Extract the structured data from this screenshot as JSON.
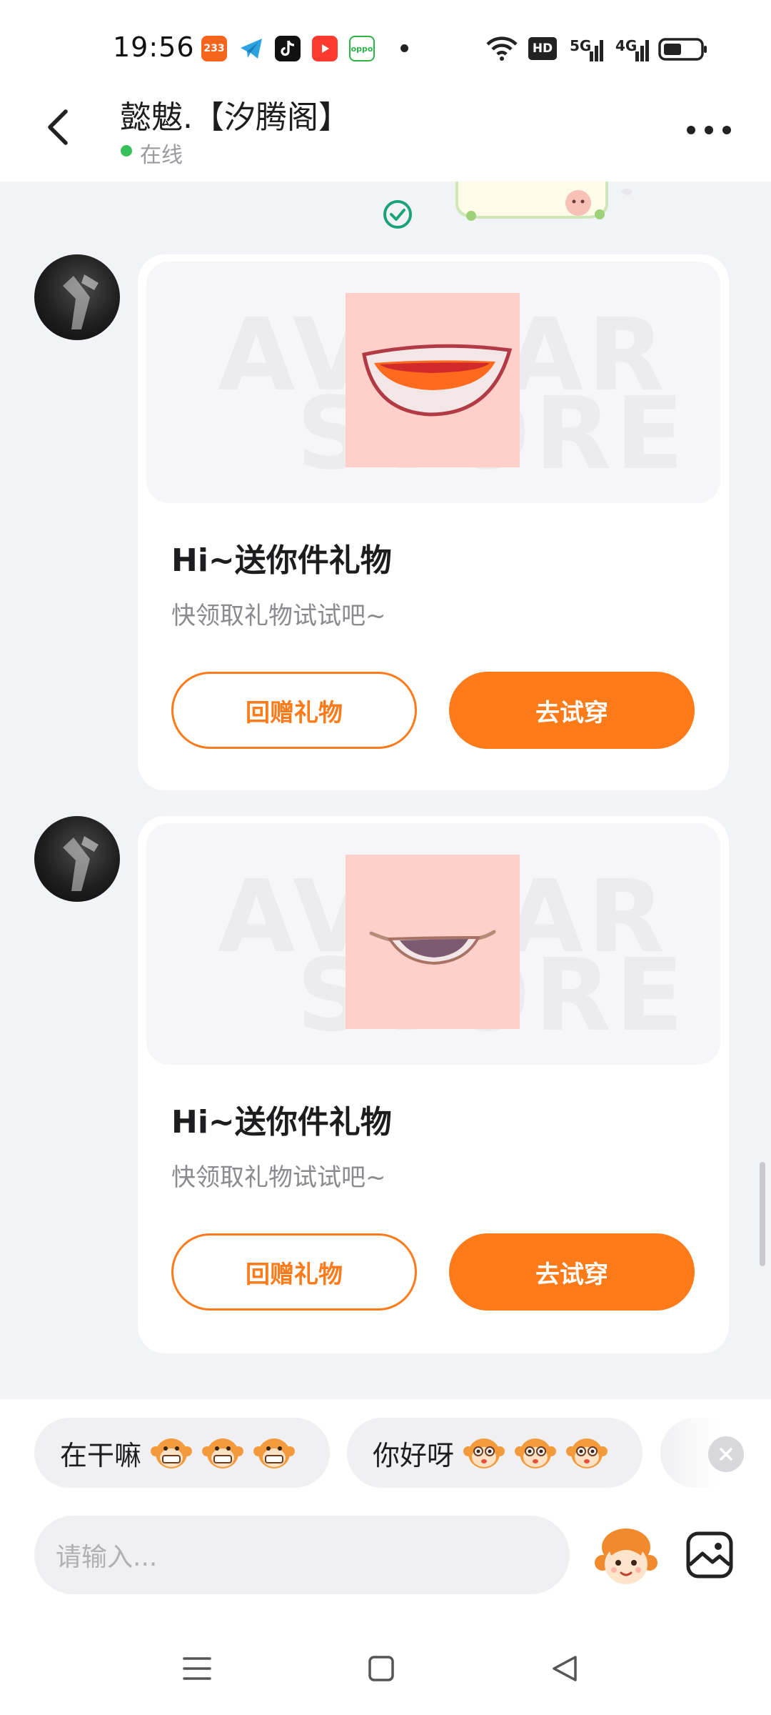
{
  "status_bar": {
    "time": "19:56",
    "notifications": [
      {
        "name": "233-app-icon",
        "label": "233",
        "color": "#f5661c"
      },
      {
        "name": "telegram-icon",
        "label": "",
        "color": "#2aa3e0"
      },
      {
        "name": "tiktok-icon",
        "label": "",
        "color": "#111111"
      },
      {
        "name": "youtube-icon",
        "label": "",
        "color": "#ff3b30"
      },
      {
        "name": "oppo-store-icon",
        "label": "oppo",
        "color": "#2db34a"
      }
    ],
    "network_labels": {
      "hd": "HD",
      "sim1": "5G",
      "sim2": "4G"
    }
  },
  "header": {
    "title": "懿魃.【汐腾阁】",
    "presence": "在线"
  },
  "messages": [
    {
      "title": "Hi~送你件礼物",
      "subtitle": "快领取礼物试试吧~",
      "return_gift_label": "回赠礼物",
      "try_on_label": "去试穿",
      "watermark_top": "AVATAR",
      "watermark_bottom": "STORE"
    },
    {
      "title": "Hi~送你件礼物",
      "subtitle": "快领取礼物试试吧~",
      "return_gift_label": "回赠礼物",
      "try_on_label": "去试穿",
      "watermark_top": "AVATAR",
      "watermark_bottom": "STORE"
    }
  ],
  "quick_replies": [
    {
      "text": "在干嘛"
    },
    {
      "text": "你好呀"
    }
  ],
  "composer": {
    "placeholder": "请输入..."
  },
  "colors": {
    "accent": "#ff7a19",
    "online": "#37c05a",
    "check": "#1aa37a"
  }
}
